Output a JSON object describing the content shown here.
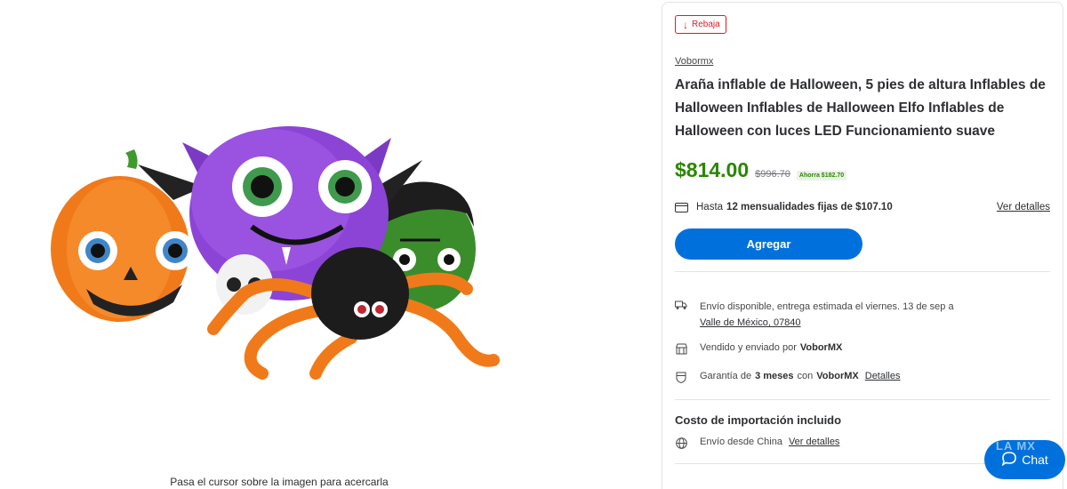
{
  "gallery": {
    "image_alt": "Araña inflable de Halloween",
    "zoom_hint": "Pasa el cursor sobre la imagen para acercarla"
  },
  "product": {
    "badge": "Rebaja",
    "seller_link": "Vobormx",
    "title": "Araña inflable de Halloween, 5 pies de altura Inflables de Halloween Inflables de Halloween Elfo Inflables de Halloween con luces LED Funcionamiento suave",
    "price": "$814.00",
    "was_price": "$996.70",
    "savings": "Ahorra $182.70"
  },
  "installments": {
    "prefix": "Hasta",
    "bold": "12 mensualidades fijas de $107.10",
    "link": "Ver detalles"
  },
  "add_button": "Agregar",
  "shipping": {
    "line1": "Envío disponible, entrega estimada el viernes. 13 de sep a",
    "location": "Valle de México, 07840"
  },
  "sold_by": {
    "prefix": "Vendido y enviado por",
    "seller": "VoborMX"
  },
  "warranty": {
    "prefix": "Garantía de",
    "months": "3 meses",
    "mid": "con",
    "seller": "VoborMX",
    "link": "Detalles"
  },
  "import": {
    "title": "Costo de importación incluido",
    "origin": "Envío desde China",
    "link": "Ver detalles"
  },
  "chat": {
    "label": "Chat",
    "watermark": "LA MX"
  },
  "colors": {
    "price_green": "#2a8703",
    "brand_blue": "#0071dc",
    "sale_red": "#de1c24"
  }
}
